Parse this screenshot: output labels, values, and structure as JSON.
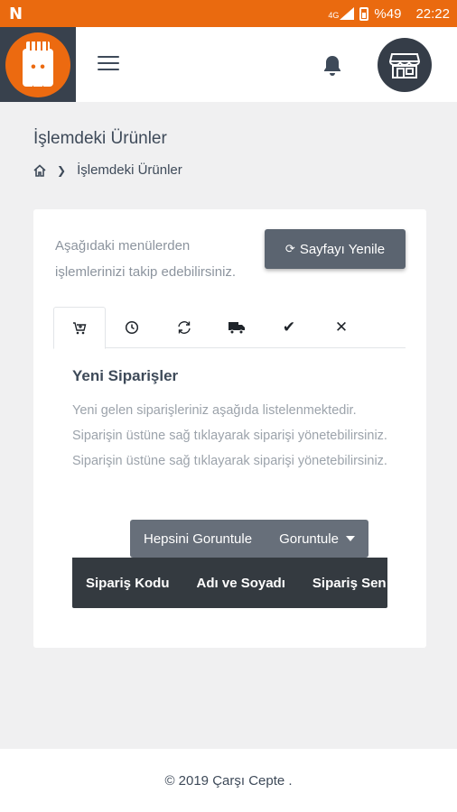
{
  "status_bar": {
    "app_icon": "N",
    "network": "4G",
    "battery": "%49",
    "time": "22:22"
  },
  "header": {
    "logo_icon": "carsi-cepte-logo-icon",
    "menu_icon": "hamburger-icon",
    "notification_icon": "bell-icon",
    "avatar_icon": "storefront-icon"
  },
  "page": {
    "title": "İşlemdeki Ürünler",
    "breadcrumb": {
      "home_icon": "home-icon",
      "current": "İşlemdeki Ürünler"
    }
  },
  "card": {
    "intro": "Aşağıdaki menülerden işlemlerinizi takip edebilirsiniz.",
    "refresh_label": "Sayfayı Yenile",
    "tabs": [
      {
        "icon": "cart-icon",
        "active": true
      },
      {
        "icon": "clock-icon",
        "active": false
      },
      {
        "icon": "sync-icon",
        "active": false
      },
      {
        "icon": "truck-icon",
        "active": false
      },
      {
        "icon": "check-icon",
        "active": false
      },
      {
        "icon": "close-icon",
        "active": false
      }
    ],
    "section_title": "Yeni Siparişler",
    "section_desc": "Yeni gelen siparişleriniz aşağıda listelenmektedir. Siparişin üstüne sağ tıklayarak siparişi yönetebilirsiniz. Siparişin üstüne sağ tıklayarak siparişi yönetebilirsiniz.",
    "view_all_label": "Hepsini Goruntule",
    "view_label": "Goruntule",
    "table": {
      "columns": [
        "Sipariş Kodu",
        "Adı ve Soyadı",
        "Sipariş Sen"
      ]
    }
  },
  "footer": {
    "text": "© 2019 Çarşı Cepte ."
  },
  "colors": {
    "brand_orange": "#ea6a0f",
    "dark": "#343a40"
  }
}
